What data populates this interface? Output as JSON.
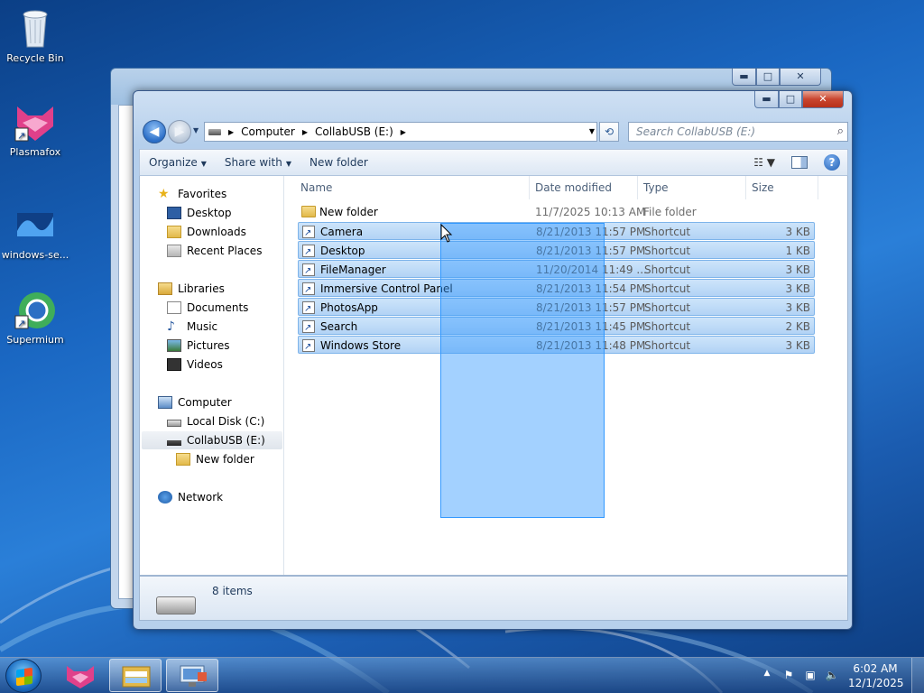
{
  "desktop": {
    "icons": [
      {
        "label": "Recycle Bin",
        "icon": "recycle-bin-icon"
      },
      {
        "label": "Plasmafox",
        "icon": "plasmafox-icon"
      },
      {
        "label": "windows-se...",
        "icon": "wave-icon"
      },
      {
        "label": "Supermium",
        "icon": "supermium-icon"
      }
    ]
  },
  "window": {
    "caption_buttons": {
      "minimize": "▬",
      "maximize": "□",
      "close": "✕"
    },
    "address": {
      "segments": [
        "Computer",
        "CollabUSB (E:)"
      ],
      "separator": "▶"
    },
    "search_placeholder": "Search CollabUSB (E:)",
    "toolbar": {
      "organize": "Organize",
      "share_with": "Share with",
      "new_folder": "New folder",
      "caret": "▼"
    },
    "nav": {
      "favorites": "Favorites",
      "desktop": "Desktop",
      "downloads": "Downloads",
      "recent_places": "Recent Places",
      "libraries": "Libraries",
      "documents": "Documents",
      "music": "Music",
      "pictures": "Pictures",
      "videos": "Videos",
      "computer": "Computer",
      "local_disk": "Local Disk (C:)",
      "collabusb": "CollabUSB (E:)",
      "new_folder": "New folder",
      "network": "Network"
    },
    "columns": {
      "name": "Name",
      "date": "Date modified",
      "type": "Type",
      "size": "Size"
    },
    "files": [
      {
        "name": "New folder",
        "date": "11/7/2025 10:13 AM",
        "type": "File folder",
        "size": "",
        "selected": false
      },
      {
        "name": "Camera",
        "date": "8/21/2013 11:57 PM",
        "type": "Shortcut",
        "size": "3 KB",
        "selected": true
      },
      {
        "name": "Desktop",
        "date": "8/21/2013 11:57 PM",
        "type": "Shortcut",
        "size": "1 KB",
        "selected": true
      },
      {
        "name": "FileManager",
        "date": "11/20/2014 11:49 ...",
        "type": "Shortcut",
        "size": "3 KB",
        "selected": true
      },
      {
        "name": "Immersive Control Panel",
        "date": "8/21/2013 11:54 PM",
        "type": "Shortcut",
        "size": "3 KB",
        "selected": true
      },
      {
        "name": "PhotosApp",
        "date": "8/21/2013 11:57 PM",
        "type": "Shortcut",
        "size": "3 KB",
        "selected": true
      },
      {
        "name": "Search",
        "date": "8/21/2013 11:45 PM",
        "type": "Shortcut",
        "size": "2 KB",
        "selected": true
      },
      {
        "name": "Windows Store",
        "date": "8/21/2013 11:48 PM",
        "type": "Shortcut",
        "size": "3 KB",
        "selected": true
      }
    ],
    "status": {
      "item_count": "8 items"
    }
  },
  "taskbar": {
    "clock_time": "6:02 AM",
    "clock_date": "12/1/2025",
    "tray_arrow": "▲"
  },
  "colors": {
    "selection": "#cde4fa",
    "marquee": "#3399ff",
    "desktop": "#1a67c2"
  }
}
